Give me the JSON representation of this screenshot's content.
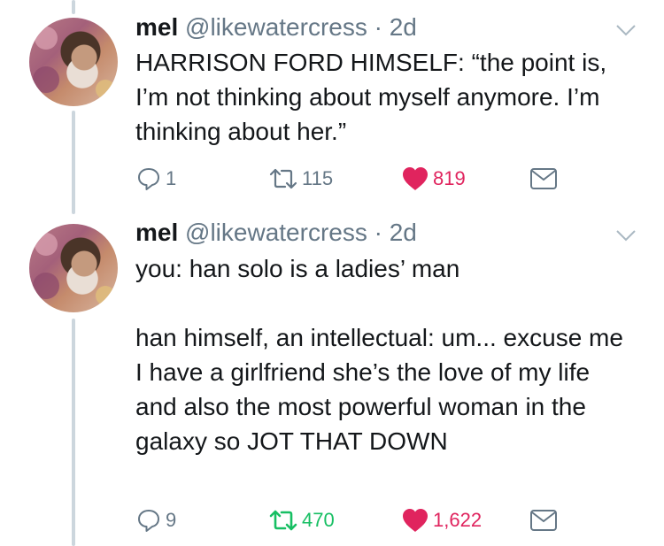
{
  "tweets": [
    {
      "display_name": "mel",
      "handle": "@likewatercress",
      "separator": "·",
      "time": "2d",
      "text": "HARRISON FORD HIMSELF: “the point is, I’m not thinking about myself anymore. I’m thinking about her.”",
      "replies": "1",
      "retweets": "115",
      "likes": "819",
      "retweeted": false,
      "liked": true
    },
    {
      "display_name": "mel",
      "handle": "@likewatercress",
      "separator": "·",
      "time": "2d",
      "text": "you: han solo is a ladies’ man\n\nhan himself, an intellectual: um... excuse me I have a girlfriend she’s the love of my life and also the most powerful woman in the galaxy so JOT THAT DOWN",
      "replies": "9",
      "retweets": "470",
      "likes": "1,622",
      "retweeted": true,
      "liked": true
    }
  ],
  "colors": {
    "text": "#14171a",
    "secondary": "#657786",
    "like": "#e0245e",
    "retweet": "#17bf63",
    "thread_line": "#ccd6dd"
  },
  "icons": [
    "reply-icon",
    "retweet-icon",
    "heart-icon",
    "direct-message-icon",
    "chevron-down-icon"
  ]
}
